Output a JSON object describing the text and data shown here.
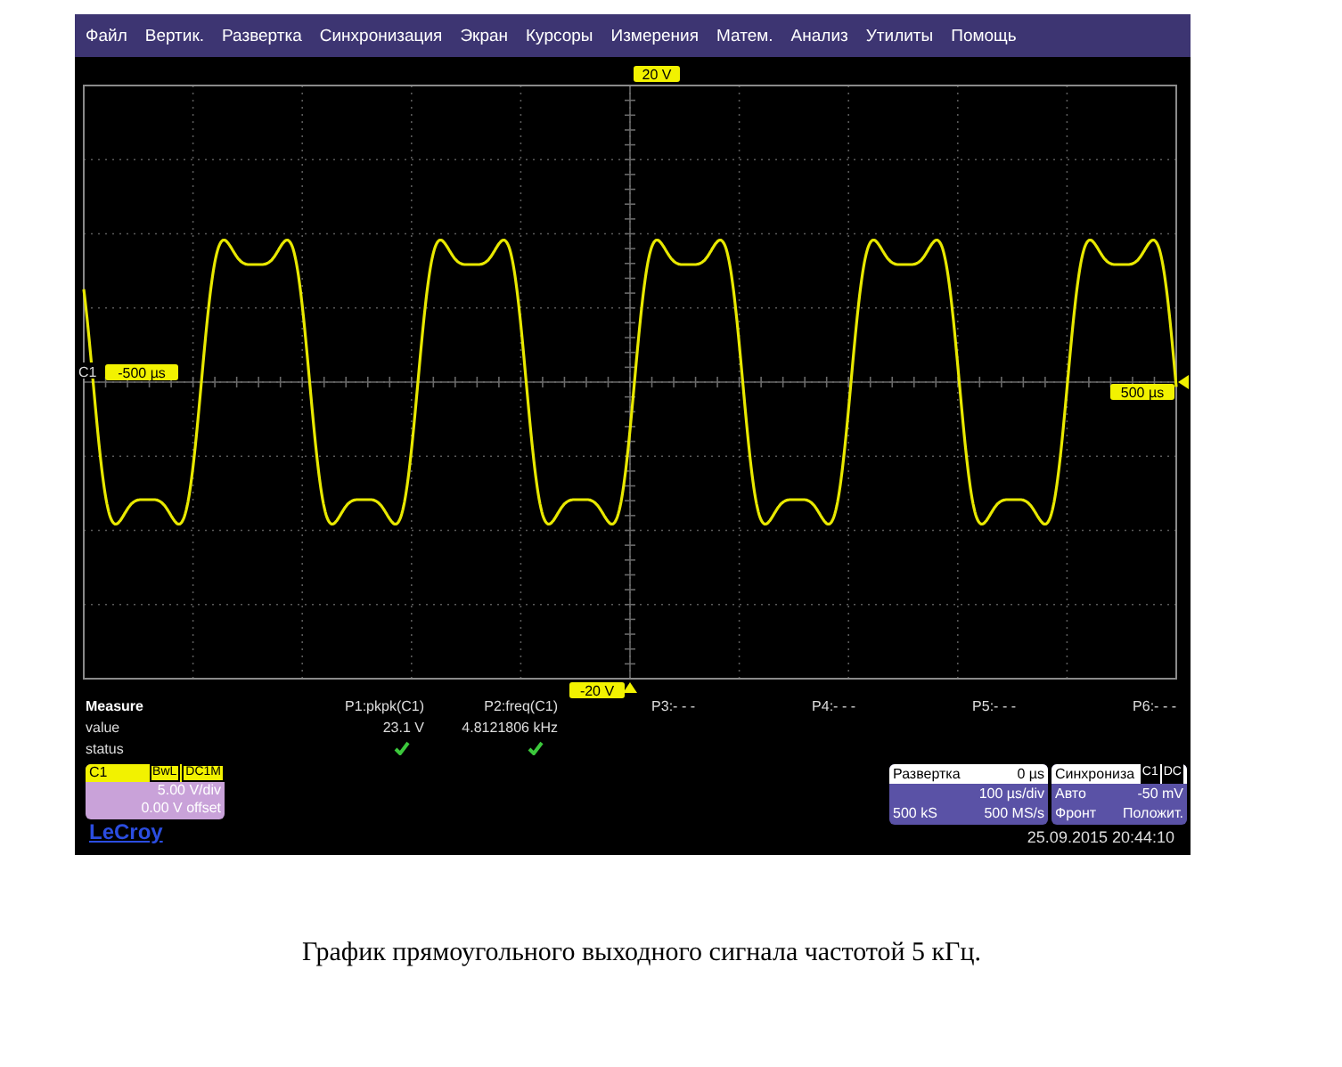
{
  "menu": [
    "Файл",
    "Вертик.",
    "Развертка",
    "Синхронизация",
    "Экран",
    "Курсоры",
    "Измерения",
    "Матем.",
    "Анализ",
    "Утилиты",
    "Помощь"
  ],
  "display": {
    "top_level": "20 V",
    "bottom_level": "-20 V",
    "channel": "C1",
    "left_time": "-500 µs",
    "right_time": "500 µs"
  },
  "measure": {
    "title": "Measure",
    "row_labels": [
      "value",
      "status"
    ],
    "params": [
      {
        "label": "P1:pkpk(C1)",
        "value": "23.1 V",
        "ok": true
      },
      {
        "label": "P2:freq(C1)",
        "value": "4.8121806 kHz",
        "ok": true
      },
      {
        "label": "P3:- - -"
      },
      {
        "label": "P4:- - -"
      },
      {
        "label": "P5:- - -"
      },
      {
        "label": "P6:- - -"
      }
    ]
  },
  "channel_box": {
    "name": "C1",
    "badges": [
      "BwL",
      "DC1M"
    ],
    "scale": "5.00 V/div",
    "offset": "0.00 V offset"
  },
  "logo": "LeCroy",
  "timebase": {
    "title": "Развертка",
    "delay": "0 µs",
    "scale": "100 µs/div",
    "samples": "500 kS",
    "rate": "500 MS/s"
  },
  "trigger": {
    "title": "Синхрониза",
    "badges": [
      "C1",
      "DC"
    ],
    "mode": "Авто",
    "level": "-50 mV",
    "type": "Фронт",
    "slope": "Положит."
  },
  "timestamp": "25.09.2015 20:44:10",
  "caption": "График прямоугольного выходного сигнала частотой 5 кГц."
}
